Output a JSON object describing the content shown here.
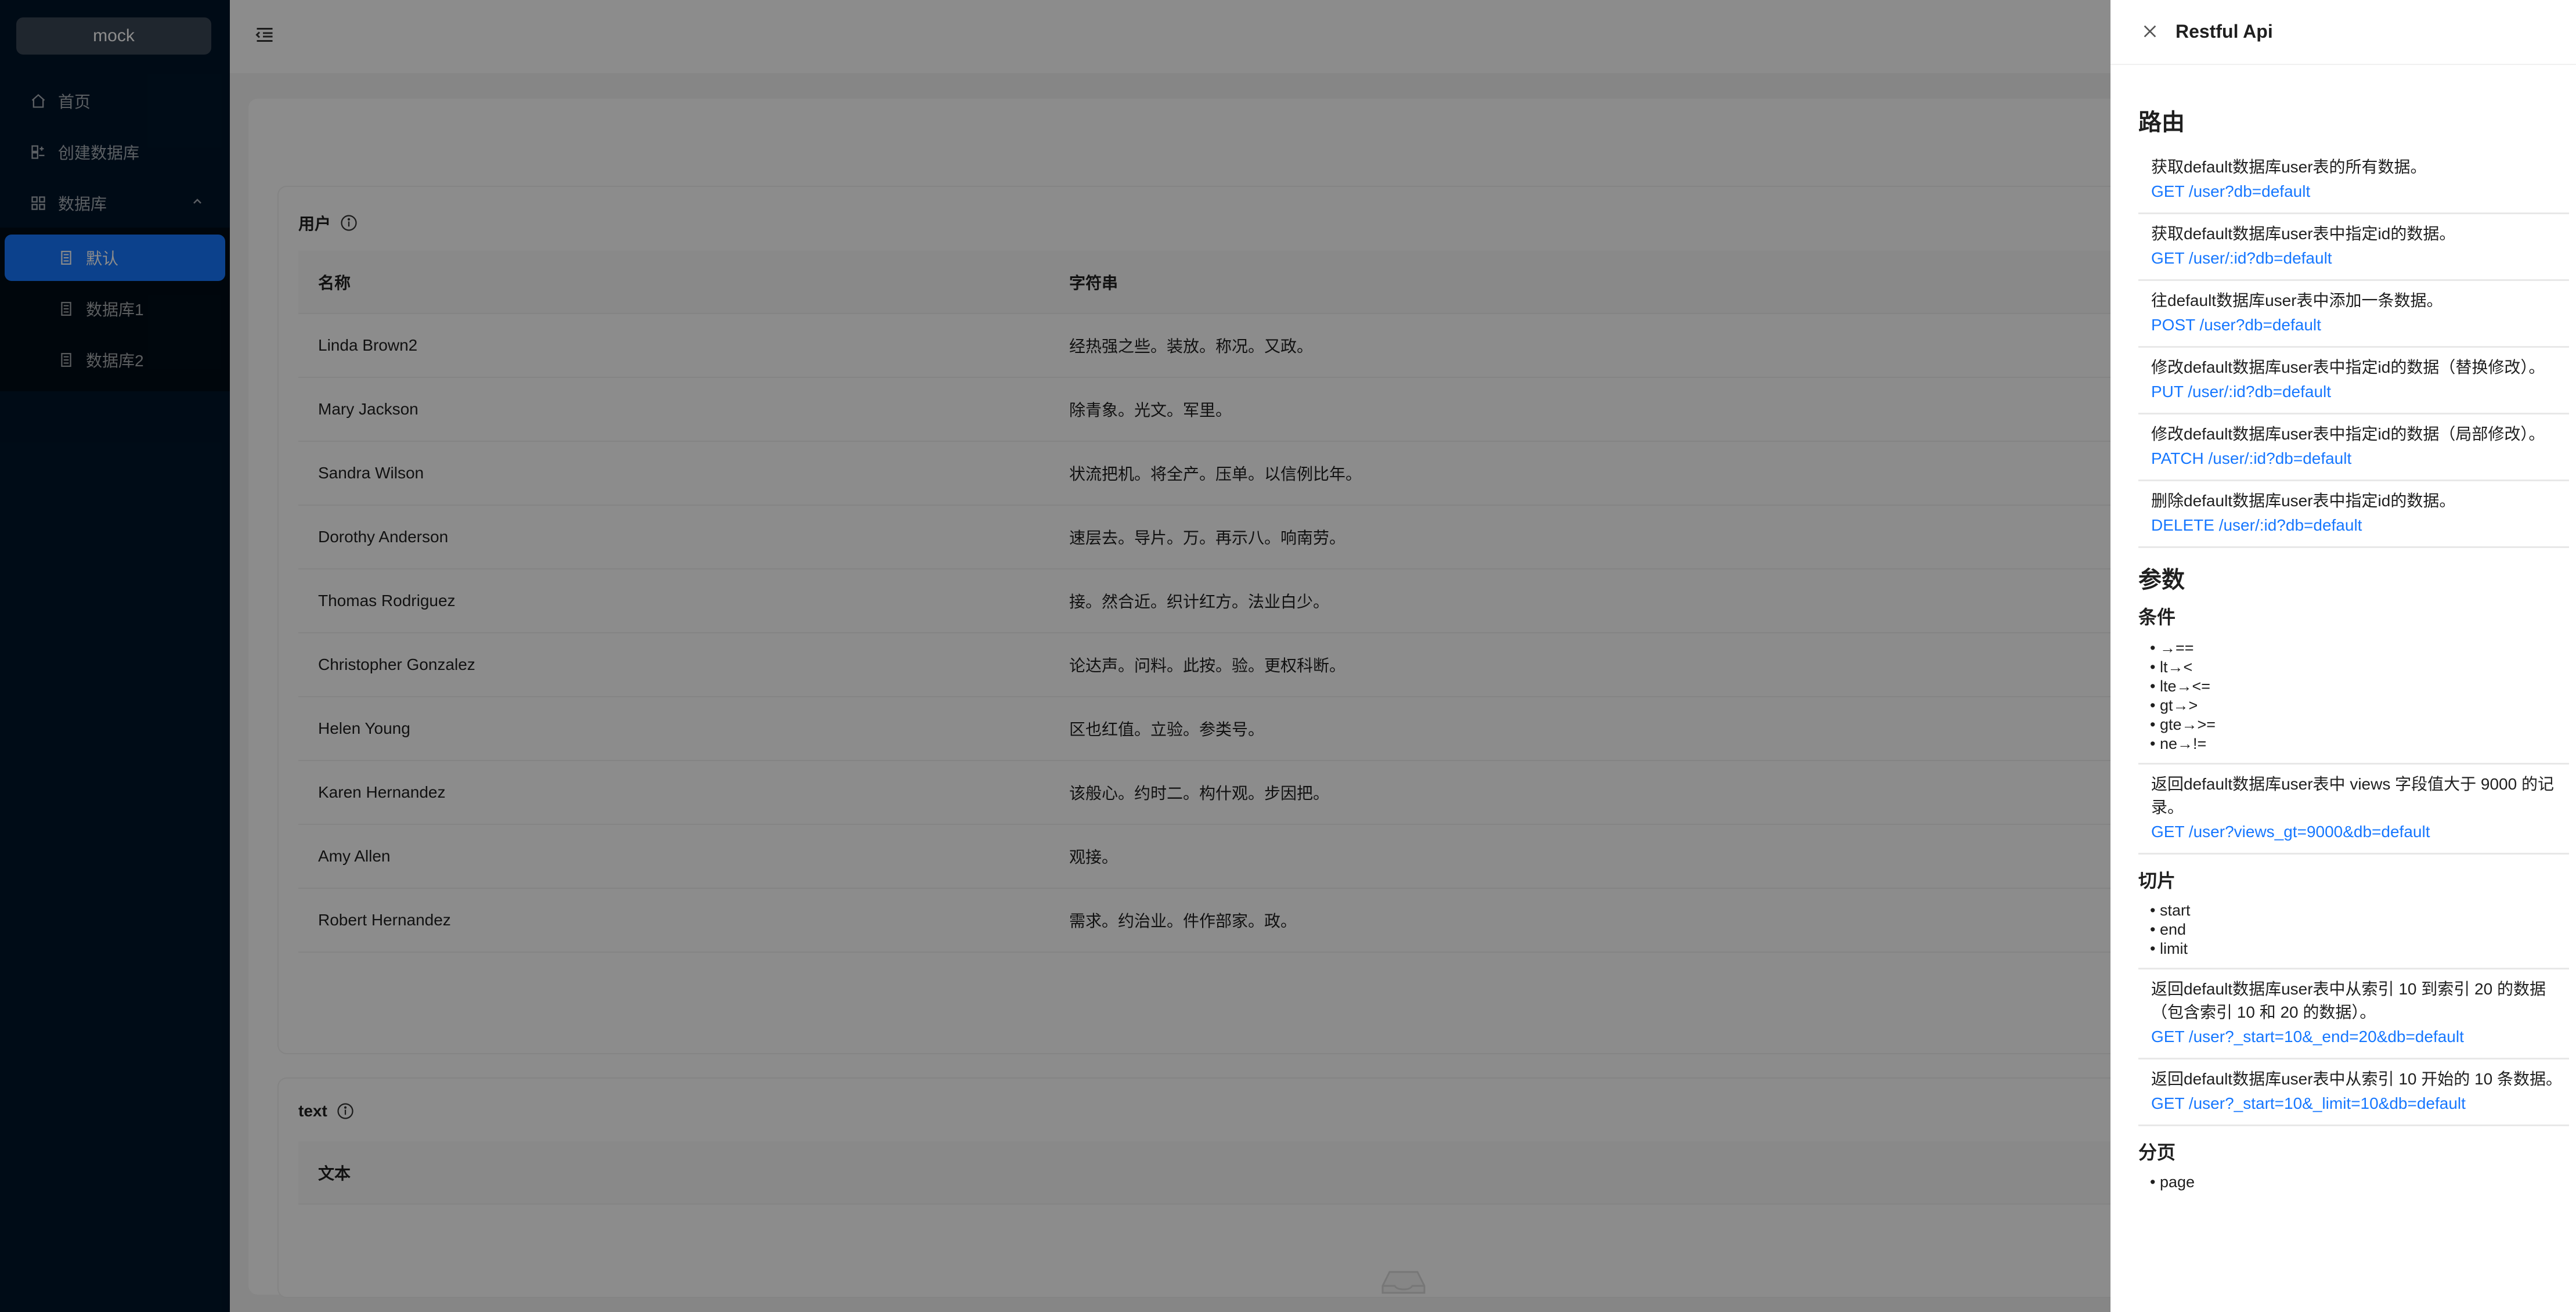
{
  "sidebar": {
    "logo": "mock",
    "items": [
      {
        "label": "首页",
        "icon": "home-icon"
      },
      {
        "label": "创建数据库",
        "icon": "database-add-icon"
      },
      {
        "label": "数据库",
        "icon": "appstore-icon"
      }
    ],
    "subitems": [
      {
        "label": "默认",
        "selected": true
      },
      {
        "label": "数据库1"
      },
      {
        "label": "数据库2"
      }
    ]
  },
  "main": {
    "user_card": {
      "title": "用户",
      "columns": [
        "名称",
        "字符串"
      ],
      "rows": [
        [
          "Linda Brown2",
          "经热强之些。装放。称况。又政。"
        ],
        [
          "Mary Jackson",
          "除青象。光文。军里。"
        ],
        [
          "Sandra Wilson",
          "状流把机。将全产。压单。以信例比年。"
        ],
        [
          "Dorothy Anderson",
          "速层去。导片。万。再示八。响南劳。"
        ],
        [
          "Thomas Rodriguez",
          "接。然合近。织计红方。法业白少。"
        ],
        [
          "Christopher Gonzalez",
          "论达声。问料。此按。验。更权科断。"
        ],
        [
          "Helen Young",
          "区也红值。立验。参类号。"
        ],
        [
          "Karen Hernandez",
          "该般心。约时二。构什观。步因把。"
        ],
        [
          "Amy Allen",
          "观接。"
        ],
        [
          "Robert Hernandez",
          "需求。约治业。件作部家。政。"
        ]
      ]
    },
    "text_card": {
      "title": "text",
      "columns": [
        "文本"
      ]
    }
  },
  "drawer": {
    "title": "Restful Api",
    "routes_heading": "路由",
    "routes": [
      {
        "desc": "获取default数据库user表的所有数据。",
        "link": "GET /user?db=default"
      },
      {
        "desc": "获取default数据库user表中指定id的数据。",
        "link": "GET /user/:id?db=default"
      },
      {
        "desc": "往default数据库user表中添加一条数据。",
        "link": "POST /user?db=default"
      },
      {
        "desc": "修改default数据库user表中指定id的数据（替换修改）。",
        "link": "PUT /user/:id?db=default"
      },
      {
        "desc": "修改default数据库user表中指定id的数据（局部修改）。",
        "link": "PATCH /user/:id?db=default"
      },
      {
        "desc": "删除default数据库user表中指定id的数据。",
        "link": "DELETE /user/:id?db=default"
      }
    ],
    "params_heading": "参数",
    "conditions_heading": "条件",
    "conditions": [
      "→==",
      "lt→<",
      "lte→<=",
      "gt→>",
      "gte→>=",
      "ne→!="
    ],
    "condition_example": {
      "desc": "返回default数据库user表中 views 字段值大于 9000 的记录。",
      "link": "GET /user?views_gt=9000&db=default"
    },
    "slice_heading": "切片",
    "slice_params": [
      "start",
      "end",
      "limit"
    ],
    "slice_examples": [
      {
        "desc": "返回default数据库user表中从索引 10 到索引 20 的数据（包含索引 10 和 20 的数据）。",
        "link": "GET /user?_start=10&_end=20&db=default"
      },
      {
        "desc": "返回default数据库user表中从索引 10 开始的 10 条数据。",
        "link": "GET /user?_start=10&_limit=10&db=default"
      }
    ],
    "paging_heading": "分页",
    "paging_params": [
      "page"
    ]
  }
}
